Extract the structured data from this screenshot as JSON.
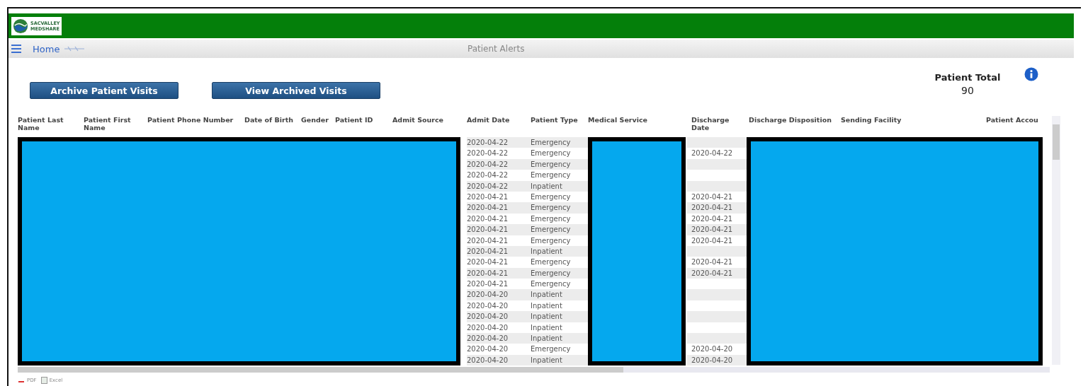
{
  "logo": {
    "line1": "SACVALLEY",
    "line2": "MEDSHARE"
  },
  "nav": {
    "home": "Home",
    "title": "Patient Alerts"
  },
  "buttons": [
    "Archive Patient Visits",
    "View Archived Visits"
  ],
  "patient_total": {
    "label": "Patient Total",
    "value": "90"
  },
  "table": {
    "columns": [
      "Patient Last Name",
      "Patient First Name",
      "Patient Phone Number",
      "Date of Birth",
      "Gender",
      "Patient ID",
      "Admit Source",
      "Admit Date",
      "Patient Type",
      "Medical Service",
      "Discharge Date",
      "Discharge Disposition",
      "Sending Facility",
      "Patient Accou"
    ],
    "rows": [
      {
        "admit_date": "2020-04-22",
        "patient_type": "Emergency"
      },
      {
        "admit_date": "2020-04-22",
        "patient_type": "Emergency",
        "discharge_date": "2020-04-22"
      },
      {
        "admit_date": "2020-04-22",
        "patient_type": "Emergency"
      },
      {
        "admit_date": "2020-04-22",
        "patient_type": "Emergency"
      },
      {
        "admit_date": "2020-04-22",
        "patient_type": "Inpatient"
      },
      {
        "admit_date": "2020-04-21",
        "patient_type": "Emergency",
        "discharge_date": "2020-04-21"
      },
      {
        "admit_date": "2020-04-21",
        "patient_type": "Emergency",
        "discharge_date": "2020-04-21"
      },
      {
        "admit_date": "2020-04-21",
        "patient_type": "Emergency",
        "discharge_date": "2020-04-21"
      },
      {
        "admit_date": "2020-04-21",
        "patient_type": "Emergency",
        "discharge_date": "2020-04-21"
      },
      {
        "admit_date": "2020-04-21",
        "patient_type": "Emergency",
        "discharge_date": "2020-04-21"
      },
      {
        "admit_date": "2020-04-21",
        "patient_type": "Inpatient"
      },
      {
        "admit_date": "2020-04-21",
        "patient_type": "Emergency",
        "discharge_date": "2020-04-21"
      },
      {
        "admit_date": "2020-04-21",
        "patient_type": "Emergency",
        "discharge_date": "2020-04-21"
      },
      {
        "admit_date": "2020-04-21",
        "patient_type": "Emergency"
      },
      {
        "admit_date": "2020-04-20",
        "patient_type": "Inpatient"
      },
      {
        "admit_date": "2020-04-20",
        "patient_type": "Inpatient"
      },
      {
        "admit_date": "2020-04-20",
        "patient_type": "Inpatient"
      },
      {
        "admit_date": "2020-04-20",
        "patient_type": "Inpatient"
      },
      {
        "admit_date": "2020-04-20",
        "patient_type": "Inpatient"
      },
      {
        "admit_date": "2020-04-20",
        "patient_type": "Emergency",
        "discharge_date": "2020-04-20"
      },
      {
        "admit_date": "2020-04-20",
        "patient_type": "Inpatient",
        "discharge_date": "2020-04-20"
      }
    ]
  },
  "exports": [
    "PDF",
    "Excel"
  ]
}
